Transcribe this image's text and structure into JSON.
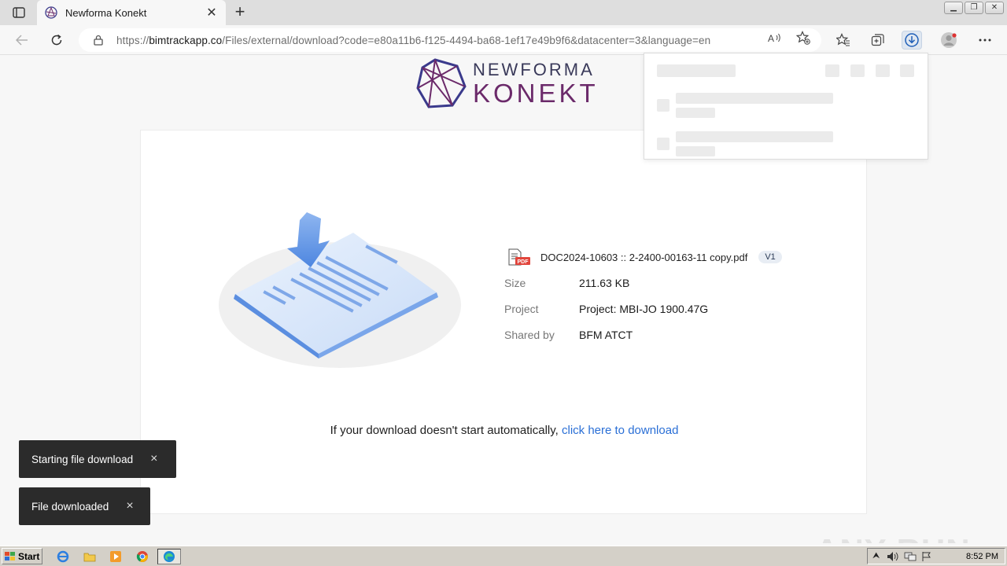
{
  "browser": {
    "tab_title": "Newforma Konekt",
    "url_prefix": "https://",
    "url_host": "bimtrackapp.co",
    "url_path": "/Files/external/download?code=e80a11b6-f125-4494-ba68-1ef17e49b9f6&datacenter=3&language=en"
  },
  "logo": {
    "line1": "NEWFORMA",
    "line2": "KONEKT"
  },
  "file": {
    "name": "DOC2024-10603 :: 2-2400-00163-11 copy.pdf",
    "version": "V1",
    "size_label": "Size",
    "size_value": "211.63 KB",
    "project_label": "Project",
    "project_value": "Project: MBI-JO 1900.47G",
    "shared_label": "Shared by",
    "shared_value": "BFM ATCT"
  },
  "download": {
    "prefix": "If your download doesn't start automatically,",
    "link": "click here",
    "suffix": "to download"
  },
  "toasts": [
    {
      "text": "Starting file download",
      "close": "×"
    },
    {
      "text": "File downloaded",
      "close": "×"
    }
  ],
  "watermark": "ANY RUN",
  "taskbar": {
    "start": "Start",
    "clock": "8:52 PM"
  },
  "colors": {
    "link": "#2a6fd6",
    "brand_purple": "#6b2a6a",
    "toast_bg": "#2b2b2b"
  }
}
